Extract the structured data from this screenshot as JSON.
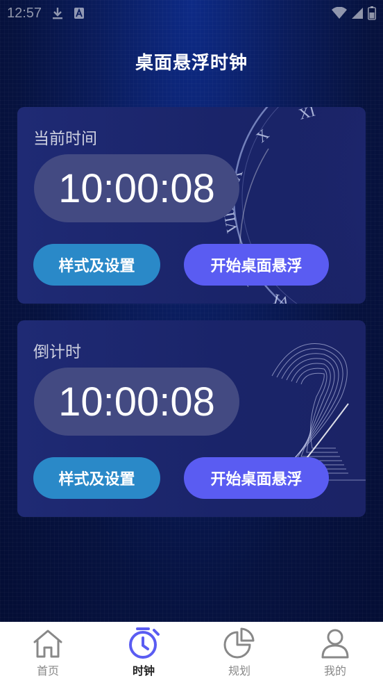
{
  "status_bar": {
    "time": "12:57"
  },
  "header": {
    "title": "桌面悬浮时钟"
  },
  "cards": [
    {
      "label": "当前时间",
      "time": "10:00:08",
      "style_button": "样式及设置",
      "float_button": "开始桌面悬浮"
    },
    {
      "label": "倒计时",
      "time": "10:00:08",
      "style_button": "样式及设置",
      "float_button": "开始桌面悬浮"
    }
  ],
  "nav": {
    "items": [
      {
        "label": "首页",
        "icon": "home-icon"
      },
      {
        "label": "时钟",
        "icon": "clock-icon",
        "active": true
      },
      {
        "label": "规划",
        "icon": "pie-chart-icon"
      },
      {
        "label": "我的",
        "icon": "person-icon"
      }
    ]
  },
  "colors": {
    "accent": "#5a5cf2",
    "secondary_button": "#2a89c8",
    "pill": "#434a82",
    "card": "#1f2a74",
    "background": "#06123f"
  }
}
